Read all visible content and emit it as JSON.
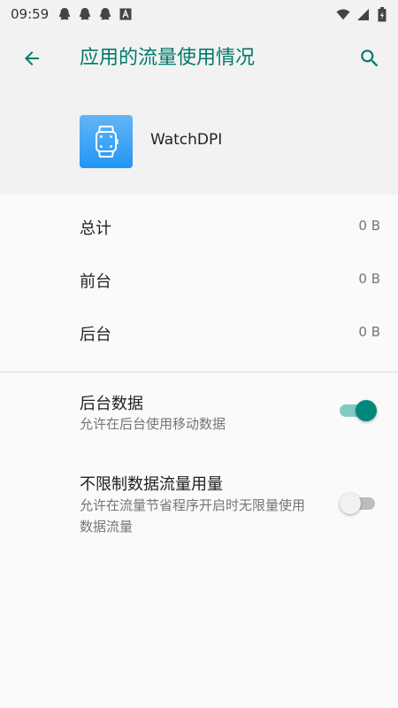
{
  "status_bar": {
    "time": "09:59",
    "left_icons": [
      "qq-icon",
      "qq-icon",
      "qq-icon",
      "a-notification-icon"
    ],
    "right_icons": [
      "wifi-icon",
      "signal-icon",
      "battery-icon"
    ]
  },
  "toolbar": {
    "title": "应用的流量使用情况",
    "back_icon": "arrow-back-icon",
    "search_icon": "search-icon",
    "accent_color": "#00796b"
  },
  "app": {
    "name": "WatchDPI",
    "icon": "watch-icon"
  },
  "usage": [
    {
      "label": "总计",
      "value": "0 B"
    },
    {
      "label": "前台",
      "value": "0 B"
    },
    {
      "label": "后台",
      "value": "0 B"
    }
  ],
  "settings": [
    {
      "title": "后台数据",
      "summary": "允许在后台使用移动数据",
      "enabled": true
    },
    {
      "title": "不限制数据流量用量",
      "summary": "允许在流量节省程序开启时无限量使用数据流量",
      "enabled": false
    }
  ]
}
